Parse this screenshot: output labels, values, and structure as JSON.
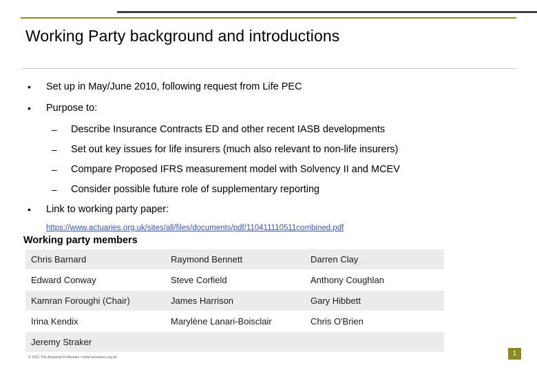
{
  "slide": {
    "title": "Working Party background and introductions",
    "page_number": "1",
    "footer": "© 2011 The Actuarial Profession • www.actuaries.org.uk",
    "accent_color": "#8a8a23",
    "link_color": "#3b55a5"
  },
  "bullets": [
    {
      "marker": "•",
      "text": "Set up in May/June 2010, following request from Life PEC"
    },
    {
      "marker": "•",
      "text": "Purpose to:"
    }
  ],
  "sub_bullets": [
    {
      "marker": "–",
      "text": "Describe Insurance Contracts ED and other recent IASB developments"
    },
    {
      "marker": "–",
      "text": "Set out key issues for life insurers (much also relevant to non-life insurers)"
    },
    {
      "marker": "–",
      "text": "Compare Proposed IFRS measurement model with Solvency II and MCEV"
    },
    {
      "marker": "–",
      "text": "Consider possible future role of supplementary reporting"
    }
  ],
  "link_bullet": {
    "marker": "•",
    "text": "Link to working party paper:",
    "url_text": "https://www.actuaries.org.uk/sites/all/files/documents/pdf/110411110511combined.pdf"
  },
  "members": {
    "heading": "Working party members",
    "rows": [
      [
        "Chris Barnard",
        "Raymond Bennett",
        "Darren Clay"
      ],
      [
        "Edward Conway",
        "Steve Corfield",
        "Anthony Coughlan"
      ],
      [
        "Kamran Foroughi (Chair)",
        "James Harrison",
        "Gary Hibbett"
      ],
      [
        "Irina Kendix",
        "Marylène Lanari-Boisclair",
        "Chris O'Brien"
      ],
      [
        "Jeremy Straker",
        "",
        ""
      ]
    ]
  }
}
